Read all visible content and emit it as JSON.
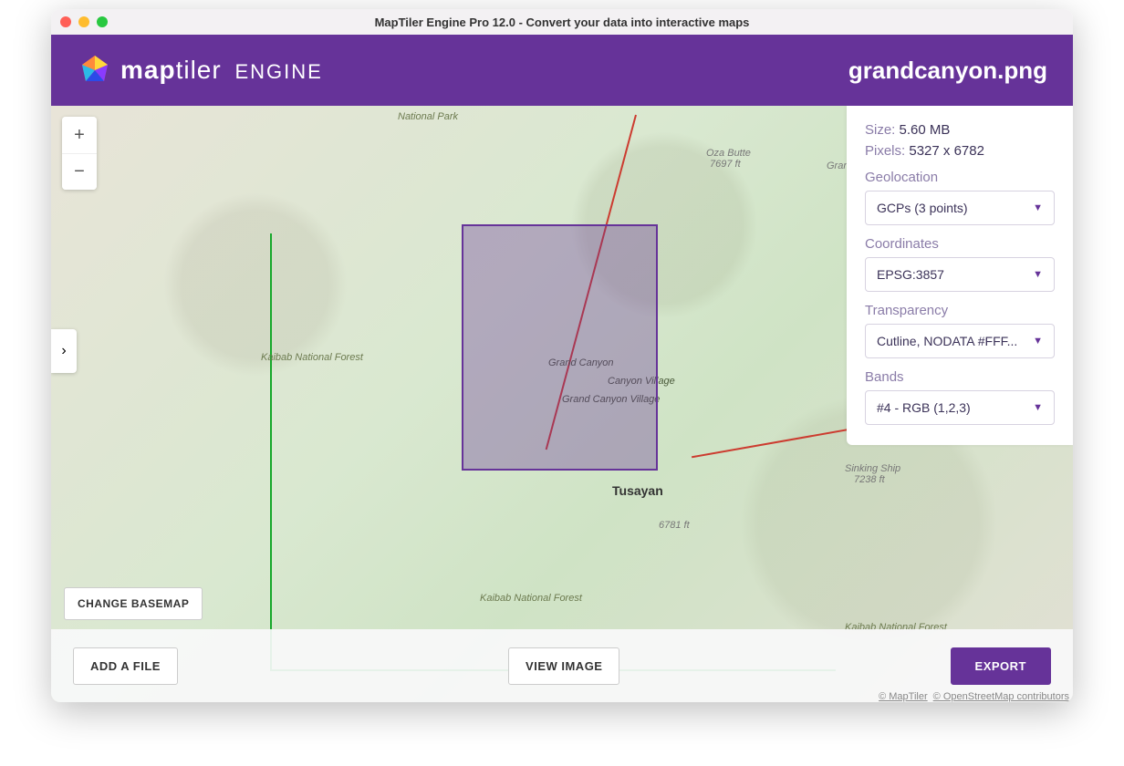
{
  "window": {
    "title": "MapTiler Engine Pro 12.0 - Convert your data into interactive maps"
  },
  "header": {
    "brand_bold": "map",
    "brand_rest": "tiler",
    "engine": "ENGINE",
    "filename": "grandcanyon.png"
  },
  "map": {
    "labels": {
      "national_park": "National Park",
      "kaibab1": "Kaibab National Forest",
      "grand_canyon": "Grand Canyon",
      "canyon_village": "Canyon Village",
      "grand_canyon_village": "Grand Canyon Village",
      "tusayan": "Tusayan",
      "kaibab2": "Kaibab National Forest",
      "kaibab3": "Kaibab National Forest",
      "oza_butte": "Oza Butte",
      "oza_butte_elev": "7697 ft",
      "peak_6781": "6781 ft",
      "sinking_ship": "Sinking Ship",
      "sinking_ship_elev": "7238 ft",
      "grand_national": "Grand National"
    },
    "change_basemap": "CHANGE BASEMAP",
    "attribution": {
      "maptiler": "© MapTiler",
      "osm": "© OpenStreetMap contributors"
    }
  },
  "panel": {
    "size_label": "Size:",
    "size_value": "5.60 MB",
    "pixels_label": "Pixels:",
    "pixels_value": "5327 x 6782",
    "geolocation_label": "Geolocation",
    "geolocation_value": "GCPs (3 points)",
    "coordinates_label": "Coordinates",
    "coordinates_value": "EPSG:3857",
    "transparency_label": "Transparency",
    "transparency_value": "Cutline, NODATA #FFF...",
    "bands_label": "Bands",
    "bands_value": "#4 - RGB (1,2,3)"
  },
  "footer": {
    "add_file": "ADD A FILE",
    "view_image": "VIEW IMAGE",
    "export": "EXPORT"
  }
}
